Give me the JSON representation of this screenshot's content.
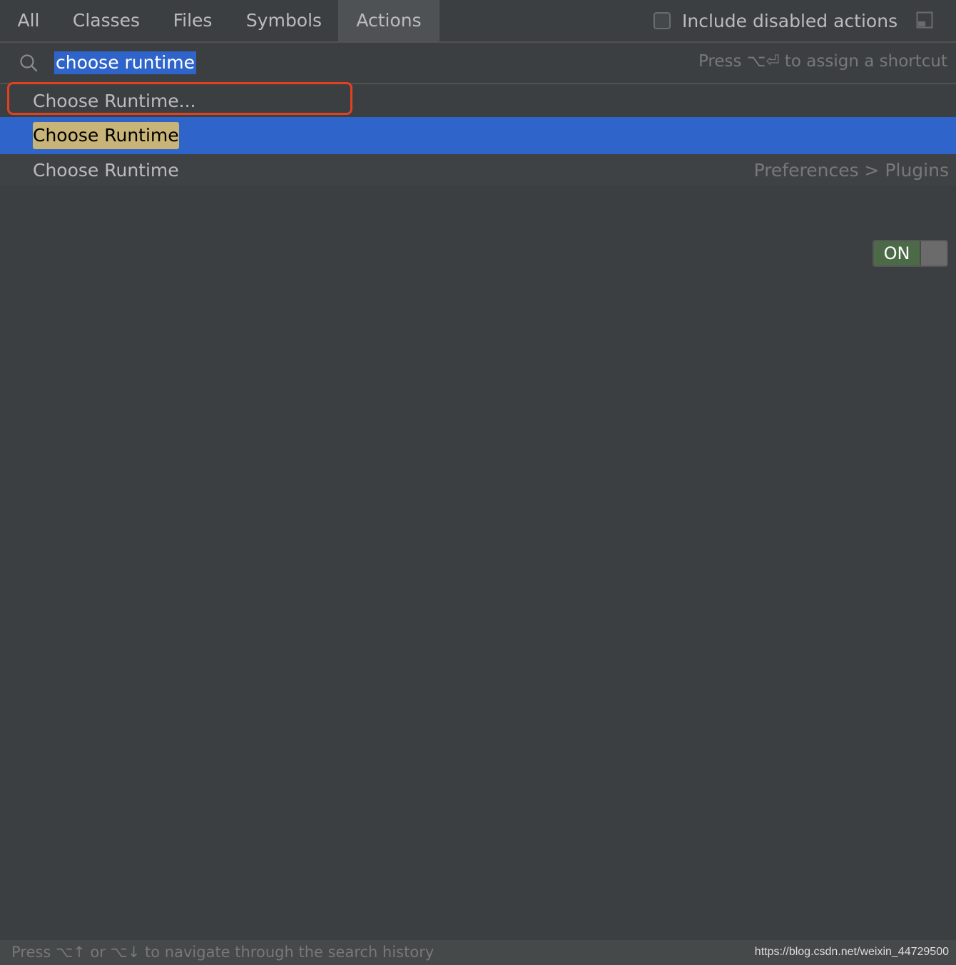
{
  "tabs": [
    {
      "label": "All"
    },
    {
      "label": "Classes"
    },
    {
      "label": "Files"
    },
    {
      "label": "Symbols"
    },
    {
      "label": "Actions",
      "active": true
    }
  ],
  "include_disabled": {
    "label": "Include disabled actions",
    "checked": false
  },
  "search": {
    "value": "choose runtime",
    "hint": "Press ⌥⏎ to assign a shortcut"
  },
  "results": [
    {
      "label": "Choose Runtime...",
      "highlighted_by_annotation": true
    },
    {
      "label": "Choose Runtime",
      "selected": true,
      "toggle": "ON"
    },
    {
      "label": "Choose Runtime",
      "path": "Preferences > Plugins"
    }
  ],
  "status": {
    "hint": "Press ⌥↑ or ⌥↓ to navigate through the search history"
  },
  "watermark": "https://blog.csdn.net/weixin_44729500",
  "colors": {
    "selection": "#2f65ca",
    "match_highlight": "#c8b477",
    "annotation": "#e2411f",
    "toggle_on": "#4c6a48"
  },
  "icons": [
    "checkbox-icon",
    "pin-window-icon",
    "search-icon"
  ]
}
